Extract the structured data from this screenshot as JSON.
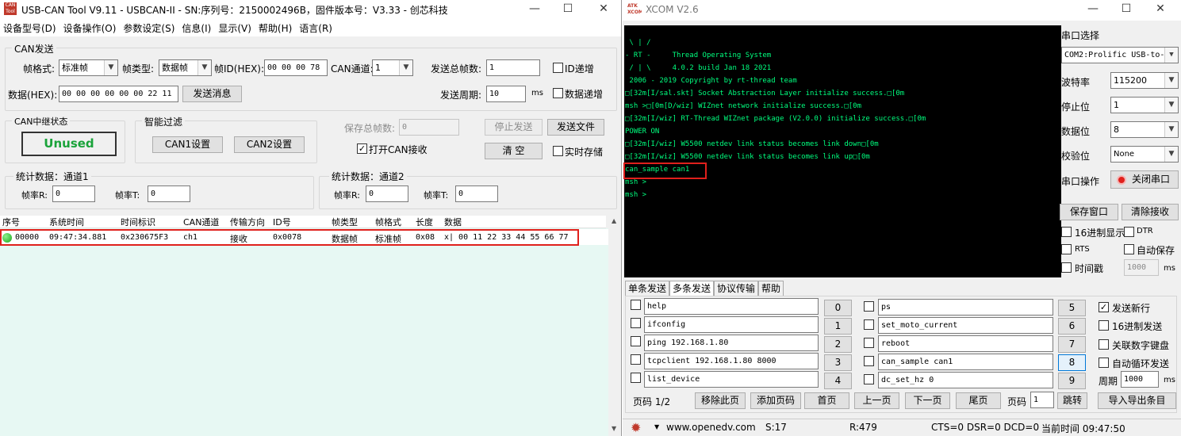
{
  "left_window": {
    "app_icon_text": "CAN Tool",
    "title": "USB-CAN Tool V9.11 - USBCAN-II - SN:序列号：2150002496B，固件版本号：V3.33 - 创芯科技",
    "menu": [
      "设备型号(D)",
      "设备操作(O)",
      "参数设定(S)",
      "信息(I)",
      "显示(V)",
      "帮助(H)",
      "语言(R)"
    ],
    "can_send": {
      "group_title": "CAN发送",
      "frame_format_label": "帧格式:",
      "frame_format_value": "标准帧",
      "frame_type_label": "帧类型:",
      "frame_type_value": "数据帧",
      "frame_id_label": "帧ID(HEX):",
      "frame_id_value": "00 00 00 78",
      "channel_label": "CAN通道:",
      "channel_value": "1",
      "total_frames_label": "发送总帧数:",
      "total_frames_value": "1",
      "id_increment_label": "ID递增",
      "data_label": "数据(HEX):",
      "data_value": "00 00 00 00 00 00 22 11",
      "send_button": "发送消息",
      "period_label": "发送周期:",
      "period_value": "10",
      "period_unit": "ms",
      "data_increment_label": "数据递增"
    },
    "relay": {
      "group_title": "CAN中继状态",
      "status": "Unused"
    },
    "filter": {
      "group_title": "智能过滤",
      "can1_button": "CAN1设置",
      "can2_button": "CAN2设置"
    },
    "save": {
      "total_saved_label": "保存总帧数:",
      "total_saved_value": "0",
      "stop_send_button": "停止发送",
      "send_file_button": "发送文件",
      "open_can_receive_label": "打开CAN接收",
      "open_can_receive_checked": true,
      "clear_button": "清 空",
      "realtime_save_label": "实时存储"
    },
    "stats1": {
      "group_title": "统计数据：通道1",
      "rate_r_label": "帧率R:",
      "rate_r_value": "0",
      "rate_t_label": "帧率T:",
      "rate_t_value": "0"
    },
    "stats2": {
      "group_title": "统计数据：通道2",
      "rate_r_label": "帧率R:",
      "rate_r_value": "0",
      "rate_t_label": "帧率T:",
      "rate_t_value": "0"
    },
    "table": {
      "headers": [
        "序号",
        "系统时间",
        "时间标识",
        "CAN通道",
        "传输方向",
        "ID号",
        "帧类型",
        "帧格式",
        "长度",
        "数据"
      ],
      "rows": [
        [
          "00000",
          "09:47:34.881",
          "0x230675F3",
          "ch1",
          "接收",
          "0x0078",
          "数据帧",
          "标准帧",
          "0x08",
          "x| 00 11 22 33 44 55 66 77"
        ]
      ]
    }
  },
  "right_window": {
    "app_icon_text": "ATK XCOM",
    "title": "XCOM V2.6",
    "terminal_lines": [
      " \\ | /",
      "- RT -     Thread Operating System",
      " / | \\     4.0.2 build Jan 18 2021",
      " 2006 - 2019 Copyright by rt-thread team",
      "□[32m[I/sal.skt] Socket Abstraction Layer initialize success.□[0m",
      "msh >□[0m[D/wiz] WIZnet network initialize success.□[0m",
      "□[32m[I/wiz] RT-Thread WIZnet package (V2.0.0) initialize success.□[0m",
      "POWER ON",
      "□[32m[I/wiz] W5500 netdev link status becomes link down□[0m",
      "□[32m[I/wiz] W5500 netdev link status becomes link up□[0m",
      "can_sample can1",
      "msh >",
      "msh >"
    ],
    "port_select_label": "串口选择",
    "port_value": "COM2:Prolific USB-to-",
    "baud_label": "波特率",
    "baud_value": "115200",
    "stop_bits_label": "停止位",
    "stop_bits_value": "1",
    "data_bits_label": "数据位",
    "data_bits_value": "8",
    "parity_label": "校验位",
    "parity_value": "None",
    "port_op_label": "串口操作",
    "close_port_button": "关闭串口",
    "save_window_button": "保存窗口",
    "clear_receive_button": "清除接收",
    "hex_display_label": "16进制显示",
    "dtr_label": "DTR",
    "rts_label": "RTS",
    "auto_save_label": "自动保存",
    "timestamp_label": "时间戳",
    "timestamp_value": "1000",
    "timestamp_unit": "ms",
    "tabs": [
      "单条发送",
      "多条发送",
      "协议传输",
      "帮助"
    ],
    "multi_send_left": [
      {
        "text": "help",
        "num": "0"
      },
      {
        "text": "ifconfig",
        "num": "1"
      },
      {
        "text": "ping 192.168.1.80",
        "num": "2"
      },
      {
        "text": "tcpclient 192.168.1.80 8000",
        "num": "3"
      },
      {
        "text": "list_device",
        "num": "4"
      }
    ],
    "multi_send_right": [
      {
        "text": "ps",
        "num": "5"
      },
      {
        "text": "set_moto_current",
        "num": "6"
      },
      {
        "text": "reboot",
        "num": "7"
      },
      {
        "text": "can_sample can1",
        "num": "8"
      },
      {
        "text": "dc_set_hz 0",
        "num": "9"
      }
    ],
    "send_newline_label": "发送新行",
    "send_newline_checked": true,
    "hex_send_label": "16进制发送",
    "numpad_label": "关联数字键盘",
    "auto_loop_label": "自动循环发送",
    "period_label": "周期",
    "period_value": "1000",
    "period_unit": "ms",
    "page_label": "页码 1/2",
    "remove_page_button": "移除此页",
    "add_page_button": "添加页码",
    "first_page_button": "首页",
    "prev_page_button": "上一页",
    "next_page_button": "下一页",
    "last_page_button": "尾页",
    "goto_page_label": "页码",
    "goto_page_value": "1",
    "jump_button": "跳转",
    "import_export_button": "导入导出条目",
    "status": {
      "url": "www.openedv.com",
      "sent": "S:17",
      "received": "R:479",
      "lines": "CTS=0 DSR=0 DCD=0",
      "time": "当前时间 09:47:50"
    }
  },
  "colors": {
    "highlight_red": "#e0201c",
    "terminal_green": "#00ff7f",
    "list_bg": "#e7f8f3",
    "unused_green": "#1aa33a"
  }
}
